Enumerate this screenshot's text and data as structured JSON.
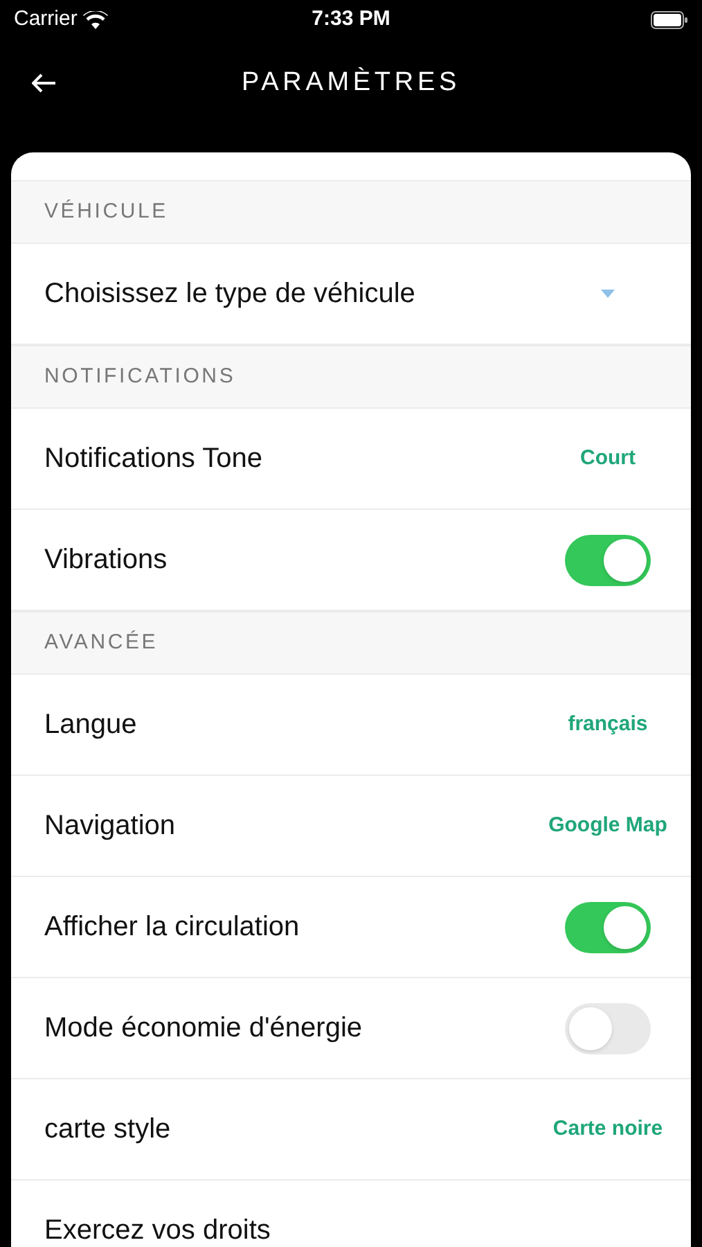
{
  "status_bar": {
    "carrier": "Carrier",
    "time": "7:33 PM"
  },
  "header": {
    "title": "PARAMÈTRES"
  },
  "sections": [
    {
      "title": "VÉHICULE",
      "items": [
        {
          "kind": "select",
          "label": "Choisissez le type de véhicule"
        }
      ]
    },
    {
      "title": "NOTIFICATIONS",
      "items": [
        {
          "kind": "value",
          "label": "Notifications Tone",
          "value": "Court"
        },
        {
          "kind": "toggle",
          "label": "Vibrations",
          "on": true
        }
      ]
    },
    {
      "title": "AVANCÉE",
      "items": [
        {
          "kind": "value",
          "label": "Langue",
          "value": "français"
        },
        {
          "kind": "value",
          "label": "Navigation",
          "value": "Google Map"
        },
        {
          "kind": "toggle",
          "label": "Afficher la circulation",
          "on": true
        },
        {
          "kind": "toggle",
          "label": "Mode économie d'énergie",
          "on": false
        },
        {
          "kind": "value",
          "label": "carte style",
          "value": "Carte noire"
        },
        {
          "kind": "link",
          "label": "Exercez vos droits"
        }
      ]
    }
  ]
}
